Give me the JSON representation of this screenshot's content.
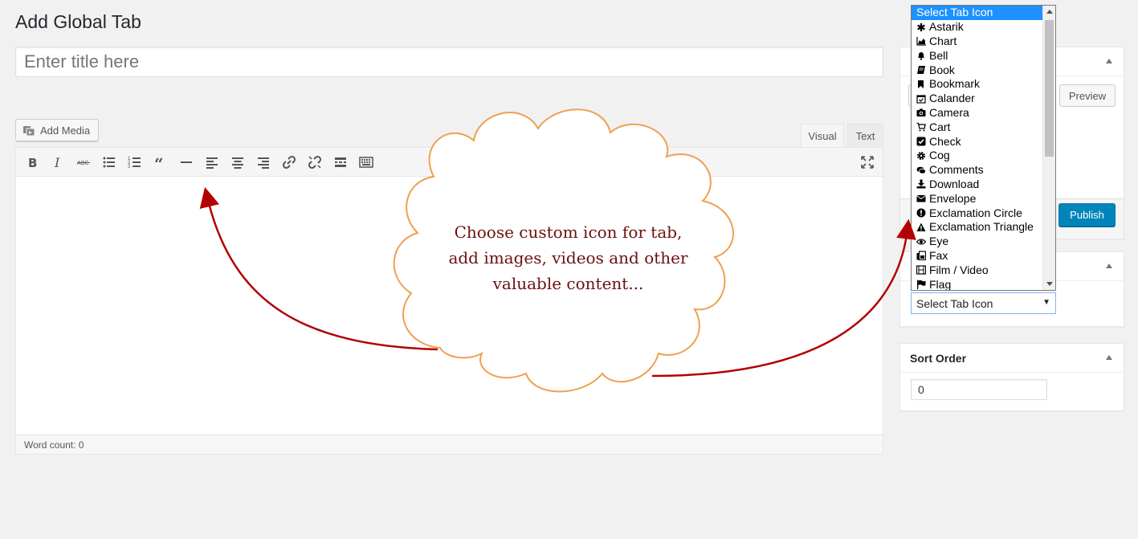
{
  "page": {
    "title": "Add Global Tab"
  },
  "title_input": {
    "placeholder": "Enter title here",
    "value": ""
  },
  "media": {
    "add_media_label": "Add Media"
  },
  "editor": {
    "tabs": [
      {
        "label": "Visual",
        "active": true
      },
      {
        "label": "Text",
        "active": false
      }
    ],
    "toolbar_icons": [
      "bold-icon",
      "italic-icon",
      "strikethrough-icon",
      "bulleted-list-icon",
      "numbered-list-icon",
      "blockquote-icon",
      "horizontal-line-icon",
      "align-left-icon",
      "align-center-icon",
      "align-right-icon",
      "link-icon",
      "unlink-icon",
      "read-more-icon",
      "toolbar-toggle-icon",
      "fullscreen-icon"
    ],
    "word_count": "Word count: 0"
  },
  "publish_box": {
    "preview_label": "Preview",
    "publish_label": "Publish"
  },
  "tab_icon": {
    "selected": "Select Tab Icon",
    "options": [
      {
        "label": "Select Tab Icon",
        "icon": "none"
      },
      {
        "label": "Astarik",
        "icon": "asterisk-icon"
      },
      {
        "label": "Chart",
        "icon": "area-chart-icon"
      },
      {
        "label": "Bell",
        "icon": "bell-icon"
      },
      {
        "label": "Book",
        "icon": "book-icon"
      },
      {
        "label": "Bookmark",
        "icon": "bookmark-icon"
      },
      {
        "label": "Calander",
        "icon": "calendar-check-icon"
      },
      {
        "label": "Camera",
        "icon": "camera-icon"
      },
      {
        "label": "Cart",
        "icon": "cart-icon"
      },
      {
        "label": "Check",
        "icon": "check-square-icon"
      },
      {
        "label": "Cog",
        "icon": "cog-icon"
      },
      {
        "label": "Comments",
        "icon": "comments-icon"
      },
      {
        "label": "Download",
        "icon": "download-icon"
      },
      {
        "label": "Envelope",
        "icon": "envelope-icon"
      },
      {
        "label": "Exclamation Circle",
        "icon": "exclamation-circle-icon"
      },
      {
        "label": "Exclamation Triangle",
        "icon": "exclamation-triangle-icon"
      },
      {
        "label": "Eye",
        "icon": "eye-icon"
      },
      {
        "label": "Fax",
        "icon": "fax-icon"
      },
      {
        "label": "Film / Video",
        "icon": "film-icon"
      },
      {
        "label": "Flag",
        "icon": "flag-icon"
      }
    ]
  },
  "sort_order": {
    "heading": "Sort Order",
    "value": "0"
  },
  "annotation": {
    "cloud_text": "Choose custom icon for tab, add images, videos and other valuable content...",
    "arrow_color": "#b30000",
    "cloud_stroke": "#f0a050"
  },
  "colors": {
    "publish": "#0085ba",
    "dropdown_selected": "#1e90ff",
    "background": "#f1f1f1"
  }
}
